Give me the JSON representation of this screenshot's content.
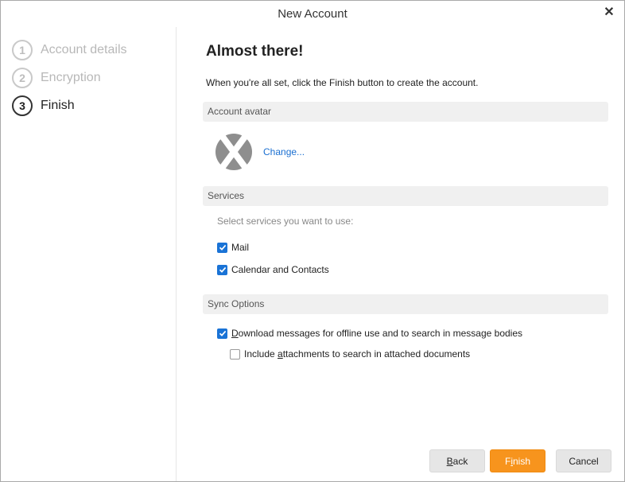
{
  "window": {
    "title": "New Account"
  },
  "steps": [
    {
      "number": "1",
      "label": "Account details"
    },
    {
      "number": "2",
      "label": "Encryption"
    },
    {
      "number": "3",
      "label": "Finish"
    }
  ],
  "main": {
    "heading": "Almost there!",
    "intro": "When you're all set, click the Finish button to create the account.",
    "avatar_section": {
      "title": "Account avatar",
      "change_link": "Change..."
    },
    "services_section": {
      "title": "Services",
      "hint": "Select services you want to use:",
      "options": [
        {
          "label": "Mail",
          "checked": true
        },
        {
          "label": "Calendar and Contacts",
          "checked": true
        }
      ]
    },
    "sync_section": {
      "title": "Sync Options",
      "download": {
        "prefix": "D",
        "rest": "ownload messages for offline use and to search in message bodies",
        "checked": true
      },
      "attachments": {
        "prefix": "Include ",
        "accel": "a",
        "rest": "ttachments to search in attached documents",
        "checked": false
      }
    }
  },
  "buttons": {
    "back": {
      "accel": "B",
      "rest": "ack"
    },
    "finish": {
      "pre": "F",
      "accel": "i",
      "rest": "nish"
    },
    "cancel": "Cancel"
  },
  "colors": {
    "accent": "#f7941d",
    "link": "#1a6fd1",
    "checkbox": "#1a73d6"
  }
}
